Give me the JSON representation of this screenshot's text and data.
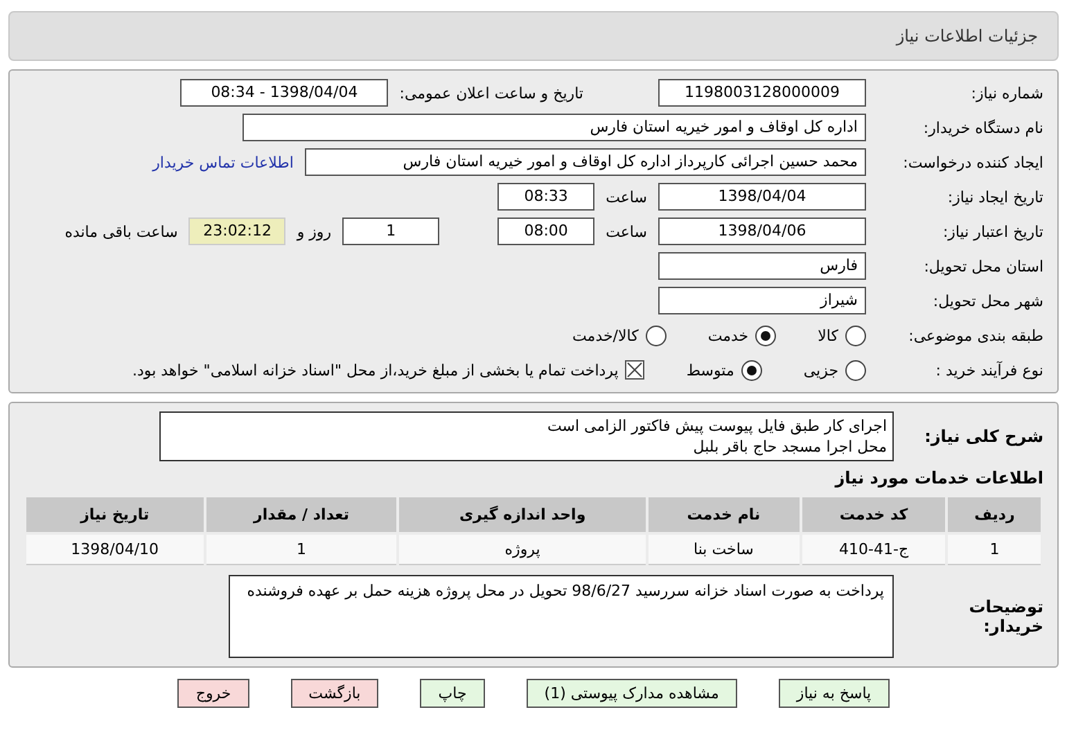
{
  "header": {
    "title": "جزئیات اطلاعات نیاز"
  },
  "form": {
    "need_number": {
      "label": "شماره نیاز:",
      "value": "1198003128000009"
    },
    "announce": {
      "label": "تاریخ و ساعت اعلان عمومی:",
      "value": "1398/04/04 - 08:34"
    },
    "buyer_org": {
      "label": "نام دستگاه خریدار:",
      "value": "اداره کل اوقاف و امور خیریه استان فارس"
    },
    "requester": {
      "label": "ایجاد کننده درخواست:",
      "value": "محمد حسین اجرائی کارپرداز اداره کل اوقاف و امور خیریه استان فارس",
      "link": "اطلاعات تماس خریدار"
    },
    "created": {
      "label": "تاریخ ایجاد نیاز:",
      "date": "1398/04/04",
      "time_label": "ساعت",
      "time": "08:33"
    },
    "validity": {
      "label": "تاریخ اعتبار نیاز:",
      "date": "1398/04/06",
      "time_label": "ساعت",
      "time": "08:00",
      "days": "1",
      "days_label": "روز و",
      "remaining": "23:02:12",
      "remaining_label": "ساعت باقی مانده"
    },
    "province": {
      "label": "استان محل تحویل:",
      "value": "فارس"
    },
    "city": {
      "label": "شهر محل تحویل:",
      "value": "شیراز"
    },
    "category": {
      "label": "طبقه بندی موضوعی:",
      "options": [
        {
          "label": "کالا",
          "selected": false
        },
        {
          "label": "خدمت",
          "selected": true
        },
        {
          "label": "کالا/خدمت",
          "selected": false
        }
      ]
    },
    "purchase_type": {
      "label": "نوع فرآیند خرید :",
      "options": [
        {
          "label": "جزیی",
          "selected": false
        },
        {
          "label": "متوسط",
          "selected": true
        }
      ],
      "payment": {
        "label": "پرداخت تمام یا بخشی از مبلغ خرید،از محل \"اسناد خزانه اسلامی\" خواهد بود.",
        "checked": true
      }
    }
  },
  "description": {
    "label": "شرح کلی نیاز:",
    "lines": [
      "اجرای کار طبق فایل پیوست پیش فاکتور الزامی است",
      "محل اجرا مسجد حاج باقر بلبل"
    ]
  },
  "services": {
    "title": "اطلاعات خدمات مورد نیاز",
    "columns": [
      "ردیف",
      "کد خدمت",
      "نام خدمت",
      "واحد اندازه گیری",
      "تعداد / مقدار",
      "تاریخ نیاز"
    ],
    "rows": [
      [
        "1",
        "ج-41-410",
        "ساخت بنا",
        "پروژه",
        "1",
        "1398/04/10"
      ]
    ]
  },
  "buyer_notes": {
    "label": "توضیحات خریدار:",
    "text": "پرداخت به صورت اسناد خزانه سررسید 98/6/27 تحویل در محل پروژه هزینه حمل بر عهده فروشنده"
  },
  "buttons": [
    {
      "label": "پاسخ به نیاز",
      "kind": "green"
    },
    {
      "label": "مشاهده مدارک پیوستی (1)",
      "kind": "green"
    },
    {
      "label": "چاپ",
      "kind": "green"
    },
    {
      "label": "بازگشت",
      "kind": "red"
    },
    {
      "label": "خروج",
      "kind": "red"
    }
  ]
}
